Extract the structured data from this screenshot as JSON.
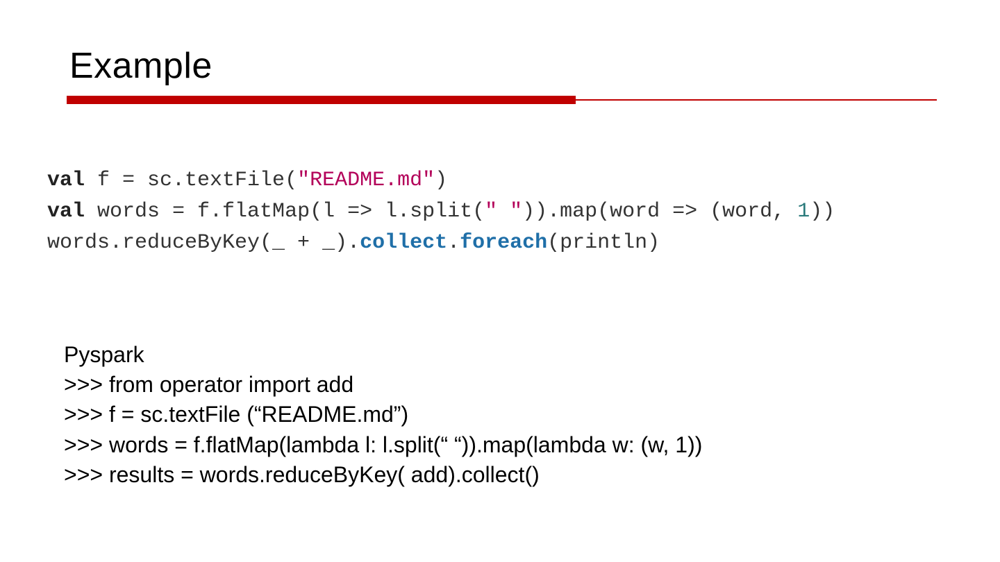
{
  "title": "Example",
  "colors": {
    "accent": "#c00000",
    "string": "#b30059",
    "number": "#2a7a7b",
    "method": "#1f6fa8"
  },
  "scala": {
    "line1": {
      "kw": "val",
      "t1": " f = sc.textFile(",
      "str": "\"README.md\"",
      "t2": ")"
    },
    "line2": {
      "kw": "val",
      "t1": " words = f.flatMap(l => l.split(",
      "str": "\" \"",
      "t2": ")).map(word => (word, ",
      "num": "1",
      "t3": "))"
    },
    "line3": {
      "t1": "words.reduceByKey(_ + _).",
      "m1": "collect",
      "dot": ".",
      "m2": "foreach",
      "t2": "(println)"
    }
  },
  "pyspark": {
    "heading": "Pyspark",
    "l1": ">>> from operator import add",
    "l2": ">>> f = sc.textFile (“README.md”)",
    "l3": ">>> words = f.flatMap(lambda l: l.split(“ “)).map(lambda w: (w, 1))",
    "l4": ">>> results = words.reduceByKey( add).collect()"
  }
}
